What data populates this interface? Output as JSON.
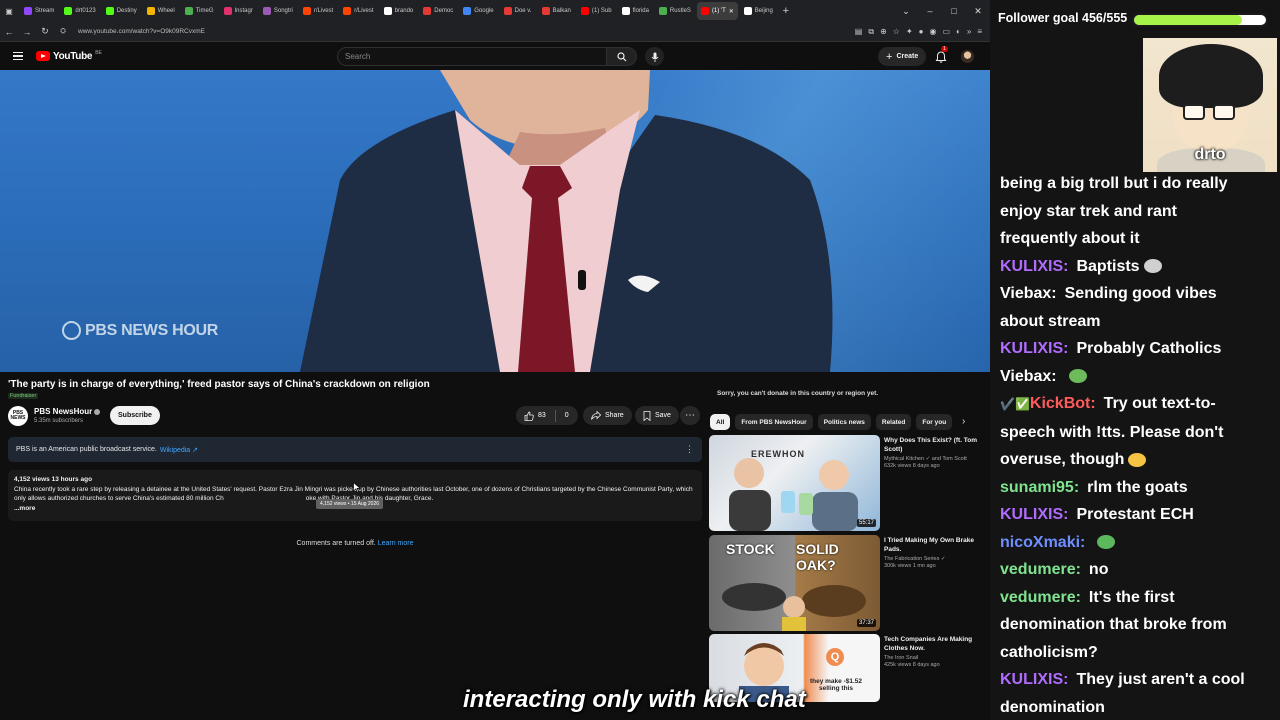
{
  "browser": {
    "tabs": [
      {
        "label": "Stream",
        "color": "#9147ff"
      },
      {
        "label": "drt0123",
        "color": "#53fc18"
      },
      {
        "label": "Destiny",
        "color": "#53fc18"
      },
      {
        "label": "Wheel",
        "color": "#f4b400"
      },
      {
        "label": "TimeG",
        "color": "#4caf50"
      },
      {
        "label": "Instagr",
        "color": "#e1306c"
      },
      {
        "label": "Songtri",
        "color": "#9b59b6"
      },
      {
        "label": "r/Livest",
        "color": "#ff4500"
      },
      {
        "label": "r/Livest",
        "color": "#ff4500"
      },
      {
        "label": "brando",
        "color": "#ffffff"
      },
      {
        "label": "Democ",
        "color": "#e53935"
      },
      {
        "label": "Google",
        "color": "#4285f4"
      },
      {
        "label": "Doe v.",
        "color": "#e53935"
      },
      {
        "label": "Balkan",
        "color": "#e53935"
      },
      {
        "label": "(1) Sub",
        "color": "#ff0000"
      },
      {
        "label": "florida",
        "color": "#ffffff"
      },
      {
        "label": "RustleS",
        "color": "#4caf50"
      },
      {
        "label": "(1) 'T",
        "color": "#ff0000",
        "active": true
      },
      {
        "label": "Beijing",
        "color": "#ffffff"
      }
    ],
    "url": "www.youtube.com/watch?v=O9k09RCvxmE"
  },
  "header": {
    "logo_word": "YouTube",
    "logo_country": "BE",
    "search_placeholder": "Search",
    "create_label": "Create",
    "notifications": "1"
  },
  "video": {
    "watermark": "PBS NEWS HOUR",
    "title": "'The party is in charge of everything,' freed pastor says of China's crackdown on religion",
    "badge": "Fundraiser"
  },
  "channel": {
    "avatar_text": "PBS NEWS",
    "name": "PBS NewsHour",
    "subscribers": "5.35m subscribers",
    "subscribe_label": "Subscribe"
  },
  "actions": {
    "likes": "83",
    "dislikes": "0",
    "share": "Share",
    "save": "Save"
  },
  "info_panel": {
    "text": "PBS is an American public broadcast service.",
    "link": "Wikipedia ↗"
  },
  "description": {
    "meta": "4,152 views  13 hours ago",
    "text": "China recently took a rare step by releasing a detainee at the United States' request. Pastor Ezra Jin Mingri was picked up by Chinese authorities last October, one of dozens of Christians targeted by the Chinese Communist Party, which only allows authorized churches to serve China's estimated 80 million Ch",
    "text_tail": "oke with Pastor Jin and his daughter, Grace.",
    "more": "...more",
    "tooltip": "4,152 views • 15 Aug 2026"
  },
  "comments": {
    "text": "Comments are turned off.",
    "link": "Learn more"
  },
  "sidebar": {
    "donate_note": "Sorry, you can't donate in this country or region yet.",
    "chips": [
      "All",
      "From PBS NewsHour",
      "Politics news",
      "Related",
      "For you"
    ],
    "recommendations": [
      {
        "title": "Why Does This Exist? (ft. Tom Scott)",
        "channel": "Mythical Kitchen ✓ and Tom Scott",
        "stats": "632k views  8 days ago",
        "duration": "55:17",
        "thumb_text": "EREWHON"
      },
      {
        "title": "I Tried Making My Own Brake Pads.",
        "channel": "The Fabrication Series ✓",
        "stats": "300k views  1 mo ago",
        "duration": "37:37",
        "thumb_text_left": "STOCK",
        "thumb_text_right": "SOLID OAK?"
      },
      {
        "title": "Tech Companies Are Making Clothes Now.",
        "channel": "The Iron Snail",
        "stats": "425k views  8 days ago",
        "duration": "",
        "thumb_text": "they make -$1.52 selling this",
        "thumb_badge": "Q"
      }
    ]
  },
  "overlay": {
    "goal_label": "Follower goal 456/555",
    "goal_fraction": 0.82,
    "webcam_label": "drto",
    "chat": [
      {
        "user": "",
        "text": "being a big troll but i do really",
        "color": "#ffffff"
      },
      {
        "user": "",
        "text": "enjoy star trek and rant",
        "color": "#ffffff"
      },
      {
        "user": "",
        "text": "frequently about it",
        "color": "#ffffff"
      },
      {
        "user": "KULIXIS:",
        "text": "Baptists",
        "color": "#b06cff",
        "emote": "#d0d0d0"
      },
      {
        "user": "Viebax:",
        "text": "Sending good vibes",
        "color": "#ffffff"
      },
      {
        "user": "",
        "text": "about stream",
        "color": "#ffffff"
      },
      {
        "user": "KULIXIS:",
        "text": "Probably Catholics",
        "color": "#b06cff"
      },
      {
        "user": "Viebax:",
        "text": "",
        "color": "#ffffff",
        "emote": "#6dbb5a"
      },
      {
        "user": "KickBot:",
        "text": "Try out text-to-",
        "color": "#ff5b5b",
        "badge": true
      },
      {
        "user": "",
        "text": "speech with !tts. Please don't",
        "color": "#ffffff"
      },
      {
        "user": "",
        "text": "overuse, though",
        "color": "#ffffff",
        "emote": "#f6c445"
      },
      {
        "user": "sunami95:",
        "text": "rlm the goats",
        "color": "#7fe38f"
      },
      {
        "user": "KULIXIS:",
        "text": "Protestant ECH",
        "color": "#b06cff"
      },
      {
        "user": "nicoXmaki:",
        "text": "",
        "color": "#6f8fff",
        "emote": "#5cb85c"
      },
      {
        "user": "vedumere:",
        "text": "no",
        "color": "#7fe38f"
      },
      {
        "user": "vedumere:",
        "text": "It's the first",
        "color": "#7fe38f"
      },
      {
        "user": "",
        "text": "denomination that broke from",
        "color": "#ffffff"
      },
      {
        "user": "",
        "text": "catholicism?",
        "color": "#ffffff"
      },
      {
        "user": "KULIXIS:",
        "text": "They just aren't a cool",
        "color": "#b06cff"
      },
      {
        "user": "",
        "text": "denomination",
        "color": "#ffffff"
      }
    ],
    "caption": "interacting only with kick chat"
  }
}
